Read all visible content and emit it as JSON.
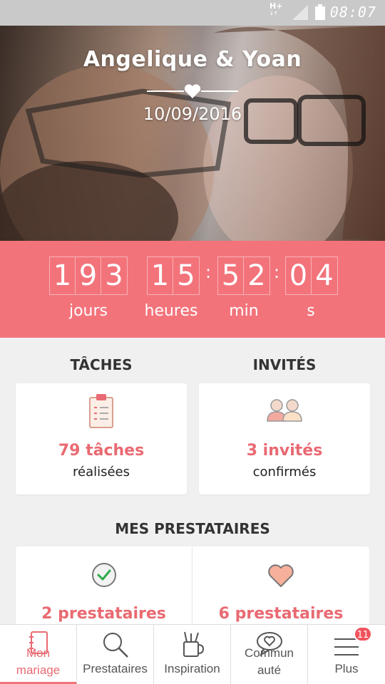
{
  "status_bar": {
    "network": "H+",
    "time": "08:07"
  },
  "hero": {
    "couple_names": "Angelique & Yoan",
    "wedding_date": "10/09/2016"
  },
  "countdown": {
    "days": [
      "1",
      "9",
      "3"
    ],
    "hours": [
      "1",
      "5"
    ],
    "minutes": [
      "5",
      "2"
    ],
    "seconds": [
      "0",
      "4"
    ],
    "days_label": "jours",
    "hours_label": "heures",
    "minutes_label": "min",
    "seconds_label": "s"
  },
  "sections": {
    "tasks_title": "TÂCHES",
    "guests_title": "INVITÉS",
    "vendors_title": "MES PRESTATAIRES"
  },
  "tasks_card": {
    "count": "79 tâches",
    "caption": "réalisées",
    "icon": "clipboard-checklist-icon"
  },
  "guests_card": {
    "count": "3 invités",
    "caption": "confirmés",
    "icon": "guests-couple-icon"
  },
  "vendors": {
    "booked": {
      "count": "2 prestataires",
      "icon": "check-circle-icon"
    },
    "favorites": {
      "count": "6 prestataires",
      "icon": "heart-icon"
    }
  },
  "bottom_nav": {
    "items": [
      {
        "label": "Mon mariage",
        "icon": "notebook-icon",
        "active": true
      },
      {
        "label": "Prestataires",
        "icon": "search-icon"
      },
      {
        "label": "Inspiration",
        "icon": "pencil-cup-icon"
      },
      {
        "label": "Communauté",
        "icon": "chat-heart-icon"
      },
      {
        "label": "Plus",
        "icon": "menu-icon"
      }
    ],
    "plus_badge": "11"
  },
  "colors": {
    "accent": "#f3737b",
    "accent_text": "#e96a72",
    "background": "#f0f0f0"
  }
}
